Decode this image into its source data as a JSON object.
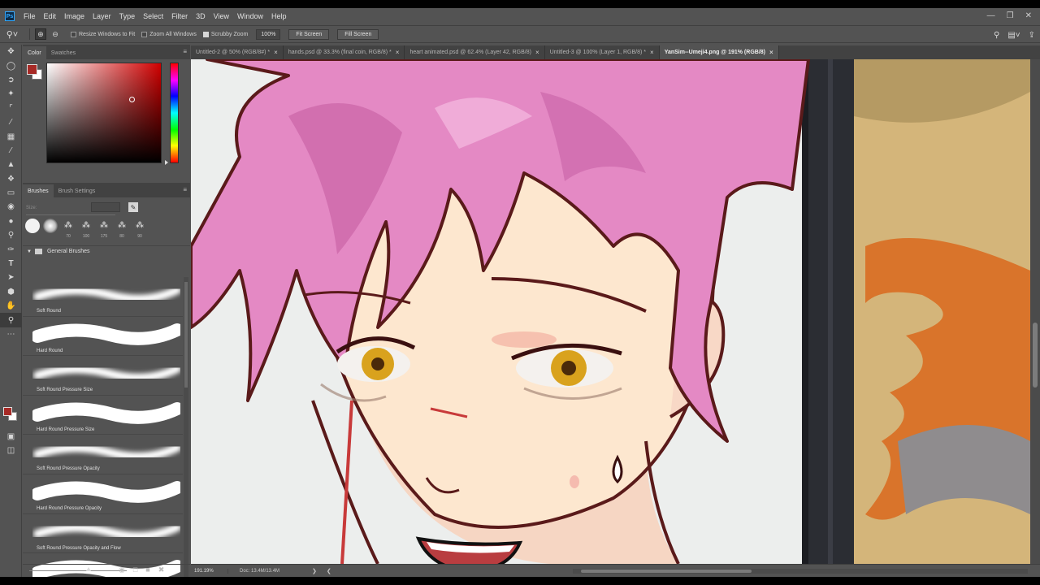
{
  "app": {
    "logo": "Ps"
  },
  "menu": [
    "File",
    "Edit",
    "Image",
    "Layer",
    "Type",
    "Select",
    "Filter",
    "3D",
    "View",
    "Window",
    "Help"
  ],
  "window_controls": [
    "minimize-icon",
    "restore-icon",
    "close-icon"
  ],
  "options": {
    "tool_icon": "zoom-icon",
    "zoom_in_icon": "zoom-in-icon",
    "zoom_out_icon": "zoom-out-icon",
    "resize_windows": {
      "label": "Resize Windows to Fit",
      "checked": false
    },
    "zoom_all_windows": {
      "label": "Zoom All Windows",
      "checked": false
    },
    "scrubby_zoom": {
      "label": "Scrubby Zoom",
      "checked": true
    },
    "zoom_value": "100%",
    "fit_screen": "Fit Screen",
    "fill_screen": "Fill Screen"
  },
  "toolbox": {
    "tools": [
      "move-icon",
      "marquee-icon",
      "lasso-icon",
      "magic-wand-icon",
      "crop-icon",
      "eyedropper-icon",
      "healing-brush-icon",
      "brush-icon",
      "clone-stamp-icon",
      "history-brush-icon",
      "eraser-icon",
      "paint-bucket-icon",
      "blur-icon",
      "dodge-icon",
      "pen-icon",
      "type-icon",
      "path-selection-icon",
      "shape-icon",
      "hand-icon",
      "zoom-icon",
      "more-tools-icon"
    ],
    "foreground": "#a72a26",
    "background": "#ffffff"
  },
  "color_panel": {
    "tabs": [
      "Color",
      "Swatches"
    ],
    "active_tab": "Color",
    "foreground": "#a72a26",
    "background": "#ffffff",
    "hue": "#d10000"
  },
  "brushes_panel": {
    "tabs": [
      "Brushes",
      "Brush Settings"
    ],
    "active_tab": "Brushes",
    "size_label": "Size:",
    "presets": [
      {
        "kind": "hard",
        "num": ""
      },
      {
        "kind": "soft",
        "num": ""
      },
      {
        "kind": "tex",
        "num": "70"
      },
      {
        "kind": "tex",
        "num": "100"
      },
      {
        "kind": "tex",
        "num": "175"
      },
      {
        "kind": "tex",
        "num": "80"
      },
      {
        "kind": "tex",
        "num": "90"
      }
    ],
    "group": "General Brushes",
    "brushes": [
      {
        "name": "Soft Round",
        "soft": true
      },
      {
        "name": "Hard Round",
        "soft": false
      },
      {
        "name": "Soft Round Pressure Size",
        "soft": true
      },
      {
        "name": "Hard Round Pressure Size",
        "soft": false
      },
      {
        "name": "Soft Round Pressure Opacity",
        "soft": true
      },
      {
        "name": "Hard Round Pressure Opacity",
        "soft": false
      },
      {
        "name": "Soft Round Pressure Opacity and Flow",
        "soft": true
      },
      {
        "name": "",
        "soft": false
      }
    ]
  },
  "doc_tabs": [
    {
      "label": "Untitled-2 @ 50% (RGB/8#) *",
      "active": false
    },
    {
      "label": "hands.psd @ 33.3% (final coin, RGB/8) *",
      "active": false
    },
    {
      "label": "heart animated.psd @ 62.4% (Layer 42, RGB/8)",
      "active": false
    },
    {
      "label": "Untitled-3 @ 100% (Layer 1, RGB/8) *",
      "active": false
    },
    {
      "label": "YanSim--Umeji4.png @ 191% (RGB/8)",
      "active": true
    }
  ],
  "status": {
    "zoom": "191.19%",
    "doc": "Doc: 13.4M/13.4M"
  },
  "colors": {
    "hair": "#e489c4",
    "hair_dark": "#c25a9f",
    "skin": "#fde7cf",
    "line": "#5a1a1a",
    "eye": "#d9a21d",
    "flame": "#d9742b",
    "wall": "#d4b57a"
  }
}
